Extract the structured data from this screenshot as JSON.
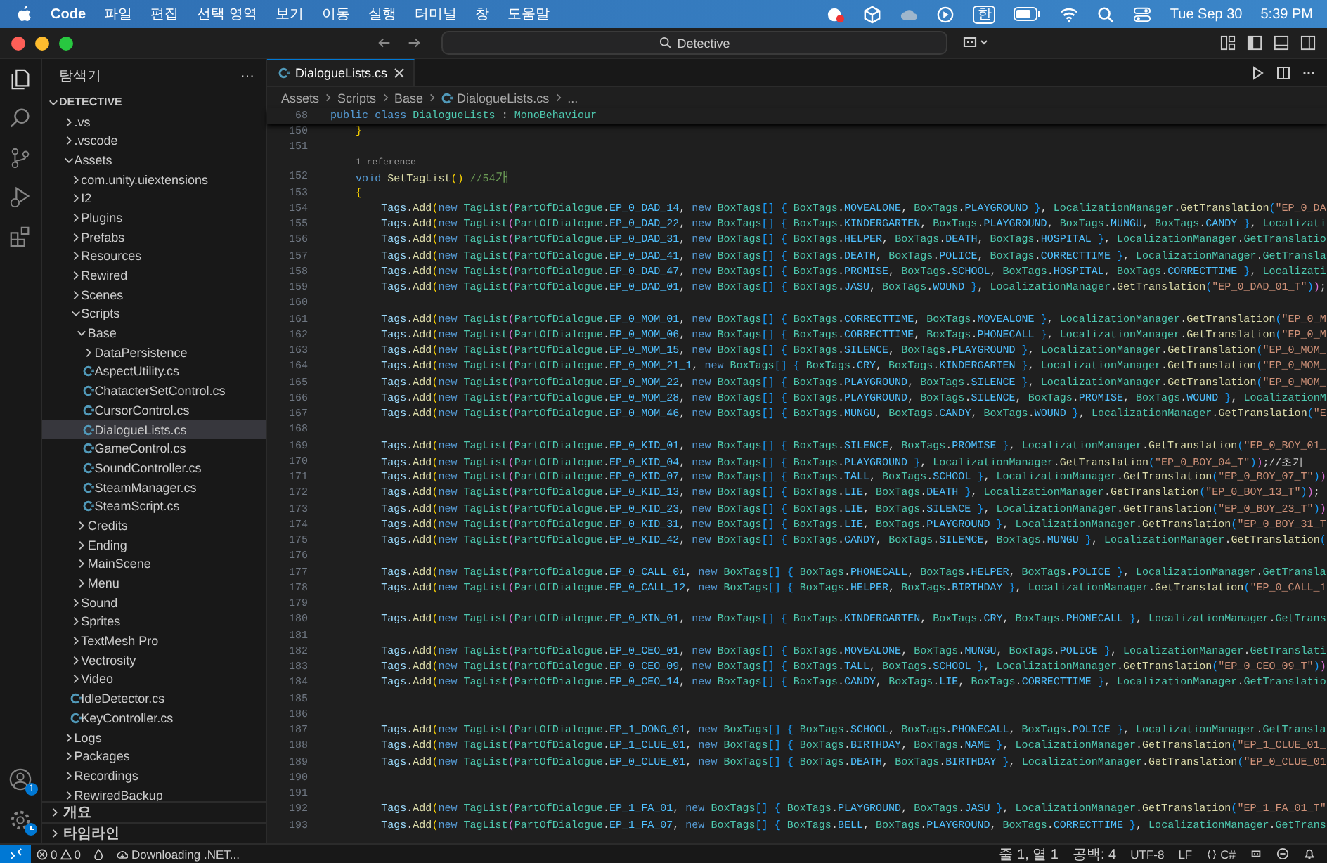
{
  "menu_bar": {
    "app_name": "Code",
    "menus": [
      "파일",
      "편집",
      "선택 영역",
      "보기",
      "이동",
      "실행",
      "터미널",
      "창",
      "도움말"
    ],
    "input_source": "한",
    "date": "Tue Sep 30",
    "time": "5:39 PM"
  },
  "window": {
    "command_center": "Detective"
  },
  "activity_bar": {
    "account_badge": "1"
  },
  "sidebar": {
    "title": "탐색기",
    "more": "···",
    "tree": {
      "label": "DETECTIVE",
      "kind": "root",
      "expanded": true,
      "children": [
        {
          "label": ".vs",
          "kind": "folder",
          "expanded": false,
          "selected": false
        },
        {
          "label": ".vscode",
          "kind": "folder",
          "expanded": false,
          "selected": false
        },
        {
          "label": "Assets",
          "kind": "folder",
          "expanded": true,
          "selected": false,
          "children": [
            {
              "label": "com.unity.uiextensions",
              "kind": "folder",
              "expanded": false,
              "selected": false
            },
            {
              "label": "I2",
              "kind": "folder",
              "expanded": false,
              "selected": false
            },
            {
              "label": "Plugins",
              "kind": "folder",
              "expanded": false,
              "selected": false
            },
            {
              "label": "Prefabs",
              "kind": "folder",
              "expanded": false,
              "selected": false
            },
            {
              "label": "Resources",
              "kind": "folder",
              "expanded": false,
              "selected": false
            },
            {
              "label": "Rewired",
              "kind": "folder",
              "expanded": false,
              "selected": false
            },
            {
              "label": "Scenes",
              "kind": "folder",
              "expanded": false,
              "selected": false
            },
            {
              "label": "Scripts",
              "kind": "folder",
              "expanded": true,
              "selected": false,
              "children": [
                {
                  "label": "Base",
                  "kind": "folder",
                  "expanded": true,
                  "selected": false,
                  "children": [
                    {
                      "label": "DataPersistence",
                      "kind": "folder",
                      "expanded": false,
                      "selected": false
                    },
                    {
                      "label": "AspectUtility.cs",
                      "kind": "file",
                      "selected": false
                    },
                    {
                      "label": "ChatacterSetControl.cs",
                      "kind": "file",
                      "selected": false
                    },
                    {
                      "label": "CursorControl.cs",
                      "kind": "file",
                      "selected": false
                    },
                    {
                      "label": "DialogueLists.cs",
                      "kind": "file",
                      "selected": true
                    },
                    {
                      "label": "GameControl.cs",
                      "kind": "file",
                      "selected": false
                    },
                    {
                      "label": "SoundController.cs",
                      "kind": "file",
                      "selected": false
                    },
                    {
                      "label": "SteamManager.cs",
                      "kind": "file",
                      "selected": false
                    },
                    {
                      "label": "SteamScript.cs",
                      "kind": "file",
                      "selected": false
                    }
                  ]
                },
                {
                  "label": "Credits",
                  "kind": "folder",
                  "expanded": false,
                  "selected": false
                },
                {
                  "label": "Ending",
                  "kind": "folder",
                  "expanded": false,
                  "selected": false
                },
                {
                  "label": "MainScene",
                  "kind": "folder",
                  "expanded": false,
                  "selected": false
                },
                {
                  "label": "Menu",
                  "kind": "folder",
                  "expanded": false,
                  "selected": false
                }
              ]
            },
            {
              "label": "Sound",
              "kind": "folder",
              "expanded": false,
              "selected": false
            },
            {
              "label": "Sprites",
              "kind": "folder",
              "expanded": false,
              "selected": false
            },
            {
              "label": "TextMesh Pro",
              "kind": "folder",
              "expanded": false,
              "selected": false
            },
            {
              "label": "Vectrosity",
              "kind": "folder",
              "expanded": false,
              "selected": false
            },
            {
              "label": "Video",
              "kind": "folder",
              "expanded": false,
              "selected": false
            },
            {
              "label": "IdleDetector.cs",
              "kind": "file",
              "selected": false
            },
            {
              "label": "KeyController.cs",
              "kind": "file",
              "selected": false
            }
          ]
        },
        {
          "label": "Logs",
          "kind": "folder",
          "expanded": false,
          "selected": false
        },
        {
          "label": "Packages",
          "kind": "folder",
          "expanded": false,
          "selected": false
        },
        {
          "label": "Recordings",
          "kind": "folder",
          "expanded": false,
          "selected": false
        },
        {
          "label": "RewiredBackup",
          "kind": "folder",
          "expanded": false,
          "selected": false
        }
      ]
    },
    "sections": [
      {
        "label": "개요",
        "expanded": false
      },
      {
        "label": "타임라인",
        "expanded": false
      }
    ]
  },
  "editor": {
    "tabs": [
      {
        "label": "DialogueLists.cs",
        "selected": true
      }
    ],
    "breadcrumb": [
      "Assets",
      "Scripts",
      "Base",
      "DialogueLists.cs",
      "..."
    ],
    "sticky_line": {
      "number": "68",
      "text": "public class DialogueLists : MonoBehaviour"
    },
    "lines": [
      {
        "kind": "code",
        "number": "150",
        "text": "    }"
      },
      {
        "kind": "code",
        "number": "151"
      },
      {
        "kind": "codelens",
        "text": "1 reference"
      },
      {
        "kind": "code",
        "number": "152",
        "text": "    void SetTagList() //54개"
      },
      {
        "kind": "code",
        "number": "153",
        "text": "    {"
      },
      {
        "kind": "code",
        "number": "154",
        "text": "        Tags.Add(new TagList(PartOfDialogue.EP_0_DAD_14, new BoxTags[] { BoxTags.MOVEALONE, BoxTags.PLAYGROUND }, LocalizationManager.GetTranslation(\"EP_0_DA"
      },
      {
        "kind": "code",
        "number": "155",
        "text": "        Tags.Add(new TagList(PartOfDialogue.EP_0_DAD_22, new BoxTags[] { BoxTags.KINDERGARTEN, BoxTags.PLAYGROUND, BoxTags.MUNGU, BoxTags.CANDY }, Localizati"
      },
      {
        "kind": "code",
        "number": "156",
        "text": "        Tags.Add(new TagList(PartOfDialogue.EP_0_DAD_31, new BoxTags[] { BoxTags.HELPER, BoxTags.DEATH, BoxTags.HOSPITAL }, LocalizationManager.GetTranslatio"
      },
      {
        "kind": "code",
        "number": "157",
        "text": "        Tags.Add(new TagList(PartOfDialogue.EP_0_DAD_41, new BoxTags[] { BoxTags.DEATH, BoxTags.POLICE, BoxTags.CORRECTTIME }, LocalizationManager.GetTransla"
      },
      {
        "kind": "code",
        "number": "158",
        "text": "        Tags.Add(new TagList(PartOfDialogue.EP_0_DAD_47, new BoxTags[] { BoxTags.PROMISE, BoxTags.SCHOOL, BoxTags.HOSPITAL, BoxTags.CORRECTTIME }, Localizati"
      },
      {
        "kind": "code",
        "number": "159",
        "text": "        Tags.Add(new TagList(PartOfDialogue.EP_0_DAD_01, new BoxTags[] { BoxTags.JASU, BoxTags.WOUND }, LocalizationManager.GetTranslation(\"EP_0_DAD_01_T\"));"
      },
      {
        "kind": "code",
        "number": "160"
      },
      {
        "kind": "code",
        "number": "161",
        "text": "        Tags.Add(new TagList(PartOfDialogue.EP_0_MOM_01, new BoxTags[] { BoxTags.CORRECTTIME, BoxTags.MOVEALONE }, LocalizationManager.GetTranslation(\"EP_0_M"
      },
      {
        "kind": "code",
        "number": "162",
        "text": "        Tags.Add(new TagList(PartOfDialogue.EP_0_MOM_06, new BoxTags[] { BoxTags.CORRECTTIME, BoxTags.PHONECALL }, LocalizationManager.GetTranslation(\"EP_0_M"
      },
      {
        "kind": "code",
        "number": "163",
        "text": "        Tags.Add(new TagList(PartOfDialogue.EP_0_MOM_15, new BoxTags[] { BoxTags.SILENCE, BoxTags.PLAYGROUND }, LocalizationManager.GetTranslation(\"EP_0_MOM_"
      },
      {
        "kind": "code",
        "number": "164",
        "text": "        Tags.Add(new TagList(PartOfDialogue.EP_0_MOM_21_1, new BoxTags[] { BoxTags.CRY, BoxTags.KINDERGARTEN }, LocalizationManager.GetTranslation(\"EP_0_MOM_"
      },
      {
        "kind": "code",
        "number": "165",
        "text": "        Tags.Add(new TagList(PartOfDialogue.EP_0_MOM_22, new BoxTags[] { BoxTags.PLAYGROUND, BoxTags.SILENCE }, LocalizationManager.GetTranslation(\"EP_0_MOM_"
      },
      {
        "kind": "code",
        "number": "166",
        "text": "        Tags.Add(new TagList(PartOfDialogue.EP_0_MOM_28, new BoxTags[] { BoxTags.PLAYGROUND, BoxTags.SILENCE, BoxTags.PROMISE, BoxTags.WOUND }, LocalizationM"
      },
      {
        "kind": "code",
        "number": "167",
        "text": "        Tags.Add(new TagList(PartOfDialogue.EP_0_MOM_46, new BoxTags[] { BoxTags.MUNGU, BoxTags.CANDY, BoxTags.WOUND }, LocalizationManager.GetTranslation(\"E"
      },
      {
        "kind": "code",
        "number": "168"
      },
      {
        "kind": "code",
        "number": "169",
        "text": "        Tags.Add(new TagList(PartOfDialogue.EP_0_KID_01, new BoxTags[] { BoxTags.SILENCE, BoxTags.PROMISE }, LocalizationManager.GetTranslation(\"EP_0_BOY_01_"
      },
      {
        "kind": "code",
        "number": "170",
        "text": "        Tags.Add(new TagList(PartOfDialogue.EP_0_KID_04, new BoxTags[] { BoxTags.PLAYGROUND }, LocalizationManager.GetTranslation(\"EP_0_BOY_04_T\"));//초기"
      },
      {
        "kind": "code",
        "number": "171",
        "text": "        Tags.Add(new TagList(PartOfDialogue.EP_0_KID_07, new BoxTags[] { BoxTags.TALL, BoxTags.SCHOOL }, LocalizationManager.GetTranslation(\"EP_0_BOY_07_T\"))"
      },
      {
        "kind": "code",
        "number": "172",
        "text": "        Tags.Add(new TagList(PartOfDialogue.EP_0_KID_13, new BoxTags[] { BoxTags.LIE, BoxTags.DEATH }, LocalizationManager.GetTranslation(\"EP_0_BOY_13_T\"));"
      },
      {
        "kind": "code",
        "number": "173",
        "text": "        Tags.Add(new TagList(PartOfDialogue.EP_0_KID_23, new BoxTags[] { BoxTags.LIE, BoxTags.SILENCE }, LocalizationManager.GetTranslation(\"EP_0_BOY_23_T\"))"
      },
      {
        "kind": "code",
        "number": "174",
        "text": "        Tags.Add(new TagList(PartOfDialogue.EP_0_KID_31, new BoxTags[] { BoxTags.LIE, BoxTags.PLAYGROUND }, LocalizationManager.GetTranslation(\"EP_0_BOY_31_T"
      },
      {
        "kind": "code",
        "number": "175",
        "text": "        Tags.Add(new TagList(PartOfDialogue.EP_0_KID_42, new BoxTags[] { BoxTags.CANDY, BoxTags.SILENCE, BoxTags.MUNGU }, LocalizationManager.GetTranslation("
      },
      {
        "kind": "code",
        "number": "176"
      },
      {
        "kind": "code",
        "number": "177",
        "text": "        Tags.Add(new TagList(PartOfDialogue.EP_0_CALL_01, new BoxTags[] { BoxTags.PHONECALL, BoxTags.HELPER, BoxTags.POLICE }, LocalizationManager.GetTransla"
      },
      {
        "kind": "code",
        "number": "178",
        "text": "        Tags.Add(new TagList(PartOfDialogue.EP_0_CALL_12, new BoxTags[] { BoxTags.HELPER, BoxTags.BIRTHDAY }, LocalizationManager.GetTranslation(\"EP_0_CALL_1"
      },
      {
        "kind": "code",
        "number": "179"
      },
      {
        "kind": "code",
        "number": "180",
        "text": "        Tags.Add(new TagList(PartOfDialogue.EP_0_KIN_01, new BoxTags[] { BoxTags.KINDERGARTEN, BoxTags.CRY, BoxTags.PHONECALL }, LocalizationManager.GetTrans"
      },
      {
        "kind": "code",
        "number": "181"
      },
      {
        "kind": "code",
        "number": "182",
        "text": "        Tags.Add(new TagList(PartOfDialogue.EP_0_CEO_01, new BoxTags[] { BoxTags.MOVEALONE, BoxTags.MUNGU, BoxTags.POLICE }, LocalizationManager.GetTranslati"
      },
      {
        "kind": "code",
        "number": "183",
        "text": "        Tags.Add(new TagList(PartOfDialogue.EP_0_CEO_09, new BoxTags[] { BoxTags.TALL, BoxTags.SCHOOL }, LocalizationManager.GetTranslation(\"EP_0_CEO_09_T\"))"
      },
      {
        "kind": "code",
        "number": "184",
        "text": "        Tags.Add(new TagList(PartOfDialogue.EP_0_CEO_14, new BoxTags[] { BoxTags.CANDY, BoxTags.LIE, BoxTags.CORRECTTIME }, LocalizationManager.GetTranslatio"
      },
      {
        "kind": "code",
        "number": "185"
      },
      {
        "kind": "code",
        "number": "186"
      },
      {
        "kind": "code",
        "number": "187",
        "text": "        Tags.Add(new TagList(PartOfDialogue.EP_1_DONG_01, new BoxTags[] { BoxTags.SCHOOL, BoxTags.PHONECALL, BoxTags.POLICE }, LocalizationManager.GetTransla"
      },
      {
        "kind": "code",
        "number": "188",
        "text": "        Tags.Add(new TagList(PartOfDialogue.EP_1_CLUE_01, new BoxTags[] { BoxTags.BIRTHDAY, BoxTags.NAME }, LocalizationManager.GetTranslation(\"EP_1_CLUE_01_"
      },
      {
        "kind": "code",
        "number": "189",
        "text": "        Tags.Add(new TagList(PartOfDialogue.EP_0_CLUE_01, new BoxTags[] { BoxTags.DEATH, BoxTags.BIRTHDAY }, LocalizationManager.GetTranslation(\"EP_0_CLUE_01"
      },
      {
        "kind": "code",
        "number": "190"
      },
      {
        "kind": "code",
        "number": "191"
      },
      {
        "kind": "code",
        "number": "192",
        "text": "        Tags.Add(new TagList(PartOfDialogue.EP_1_FA_01, new BoxTags[] { BoxTags.PLAYGROUND, BoxTags.JASU }, LocalizationManager.GetTranslation(\"EP_1_FA_01_T\""
      },
      {
        "kind": "code",
        "number": "193",
        "text": "        Tags.Add(new TagList(PartOfDialogue.EP_1_FA_07, new BoxTags[] { BoxTags.BELL, BoxTags.PLAYGROUND, BoxTags.CORRECTTIME }, LocalizationManager.GetTrans"
      }
    ]
  },
  "status_bar": {
    "errors": "0",
    "warnings": "0",
    "task": "Downloading .NET...",
    "position": "줄 1, 열 1",
    "indent": "공백: 4",
    "encoding": "UTF-8",
    "eol": "LF",
    "language": "C#"
  }
}
